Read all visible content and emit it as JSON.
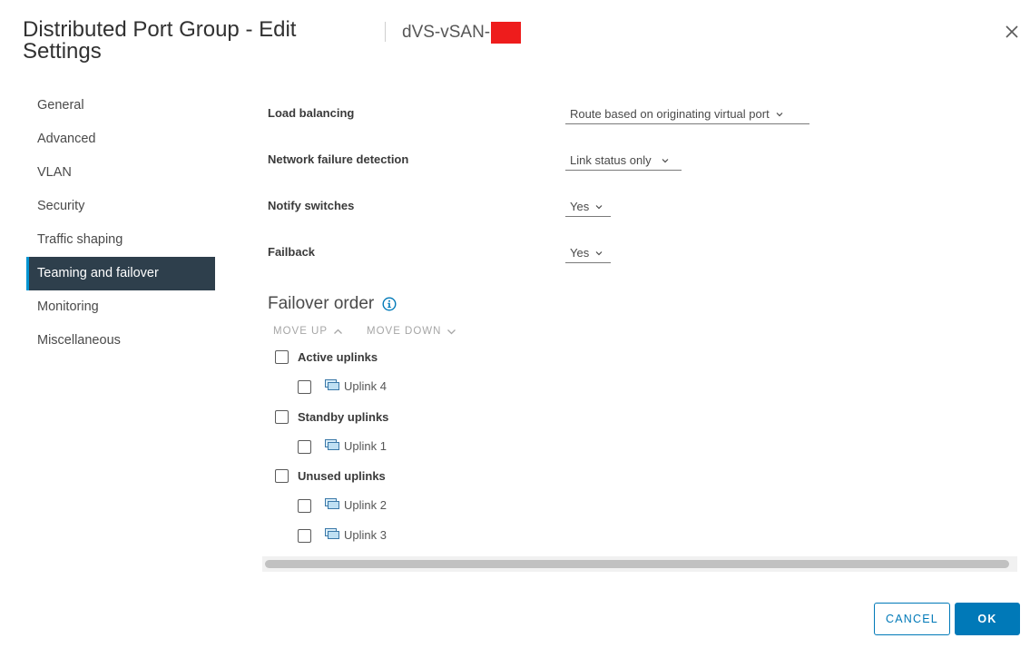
{
  "header": {
    "title": "Distributed Port Group - Edit Settings",
    "subtitle": "dVS-vSAN-",
    "close_icon": "close-icon"
  },
  "sidebar": {
    "items": [
      {
        "label": "General",
        "active": false
      },
      {
        "label": "Advanced",
        "active": false
      },
      {
        "label": "VLAN",
        "active": false
      },
      {
        "label": "Security",
        "active": false
      },
      {
        "label": "Traffic shaping",
        "active": false
      },
      {
        "label": "Teaming and failover",
        "active": true
      },
      {
        "label": "Monitoring",
        "active": false
      },
      {
        "label": "Miscellaneous",
        "active": false
      }
    ]
  },
  "form": {
    "load_balancing": {
      "label": "Load balancing",
      "value": "Route based on originating virtual port"
    },
    "network_failure_detection": {
      "label": "Network failure detection",
      "value": "Link status only"
    },
    "notify_switches": {
      "label": "Notify switches",
      "value": "Yes"
    },
    "failback": {
      "label": "Failback",
      "value": "Yes"
    }
  },
  "failover": {
    "title": "Failover order",
    "move_up": "MOVE UP",
    "move_down": "MOVE DOWN",
    "groups": [
      {
        "label": "Active uplinks",
        "uplinks": [
          "Uplink 4"
        ]
      },
      {
        "label": "Standby uplinks",
        "uplinks": [
          "Uplink 1"
        ]
      },
      {
        "label": "Unused uplinks",
        "uplinks": [
          "Uplink 2",
          "Uplink 3"
        ]
      }
    ]
  },
  "footer": {
    "cancel_label": "CANCEL",
    "ok_label": "OK"
  },
  "colors": {
    "accent": "#0079b8",
    "nav_active_bg": "#2e3f4c",
    "nav_active_border": "#0094d2",
    "redaction": "#ee1c1c"
  }
}
